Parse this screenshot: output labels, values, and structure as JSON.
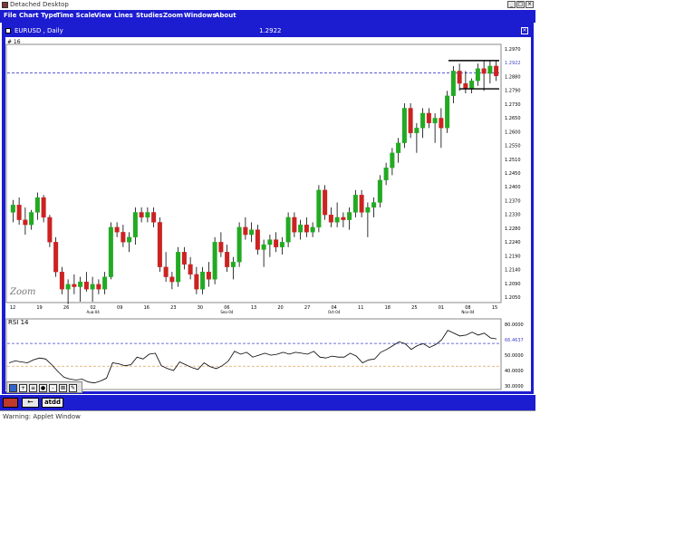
{
  "window": {
    "title": "Detached Desktop",
    "btn_min": "_",
    "btn_max": "□",
    "btn_close": "×"
  },
  "menu": [
    "File",
    "Chart Type",
    "Time Scale",
    "View",
    "Lines",
    "Studies",
    "Zoom",
    "Windows",
    "About"
  ],
  "symbol_bar": {
    "label": "EURUSD , Daily",
    "last_price": "1.2922",
    "close": "×"
  },
  "chart_panel_label": "# 16",
  "zoom_label": "Zoom",
  "chart_data": {
    "type": "candlestick",
    "title": "EURUSD , Daily",
    "last_price_line": 1.2922,
    "ylim": [
      1.2,
      1.303
    ],
    "y_ticks": [
      "1.2970",
      "1.2922",
      "1.2880",
      "1.2790",
      "1.2730",
      "1.2650",
      "1.2600",
      "1.2550",
      "1.2510",
      "1.2450",
      "1.2400",
      "1.2370",
      "1.2330",
      "1.2280",
      "1.2240",
      "1.2190",
      "1.2140",
      "1.2090",
      "1.2050"
    ],
    "x_ticks": [
      "12",
      "19",
      "26",
      "02",
      "09",
      "16",
      "23",
      "30",
      "06",
      "13",
      "20",
      "27",
      "04",
      "11",
      "18",
      "25",
      "01",
      "08",
      "15"
    ],
    "x_tick_sub": [
      {
        "after_index": 3,
        "label": "Aug-04"
      },
      {
        "after_index": 8,
        "label": "Sep-04"
      },
      {
        "after_index": 12,
        "label": "Oct-04"
      },
      {
        "after_index": 17,
        "label": "Nov-04"
      }
    ],
    "candles": [
      [
        1.236,
        1.241,
        1.232,
        1.239
      ],
      [
        1.239,
        1.242,
        1.231,
        1.233
      ],
      [
        1.233,
        1.238,
        1.227,
        1.231
      ],
      [
        1.231,
        1.237,
        1.229,
        1.236
      ],
      [
        1.236,
        1.244,
        1.233,
        1.242
      ],
      [
        1.242,
        1.243,
        1.232,
        1.234
      ],
      [
        1.234,
        1.235,
        1.222,
        1.224
      ],
      [
        1.224,
        1.226,
        1.21,
        1.212
      ],
      [
        1.212,
        1.214,
        1.203,
        1.205
      ],
      [
        1.205,
        1.209,
        1.199,
        1.207
      ],
      [
        1.207,
        1.211,
        1.203,
        1.206
      ],
      [
        1.206,
        1.21,
        1.2,
        1.208
      ],
      [
        1.208,
        1.212,
        1.204,
        1.205
      ],
      [
        1.205,
        1.21,
        1.2,
        1.207
      ],
      [
        1.207,
        1.209,
        1.203,
        1.205
      ],
      [
        1.205,
        1.212,
        1.203,
        1.21
      ],
      [
        1.21,
        1.232,
        1.209,
        1.23
      ],
      [
        1.23,
        1.232,
        1.226,
        1.228
      ],
      [
        1.228,
        1.231,
        1.222,
        1.224
      ],
      [
        1.224,
        1.228,
        1.22,
        1.226
      ],
      [
        1.226,
        1.238,
        1.223,
        1.236
      ],
      [
        1.236,
        1.238,
        1.232,
        1.234
      ],
      [
        1.234,
        1.238,
        1.232,
        1.236
      ],
      [
        1.236,
        1.238,
        1.23,
        1.232
      ],
      [
        1.232,
        1.234,
        1.212,
        1.214
      ],
      [
        1.214,
        1.22,
        1.208,
        1.21
      ],
      [
        1.21,
        1.212,
        1.205,
        1.208
      ],
      [
        1.208,
        1.222,
        1.206,
        1.22
      ],
      [
        1.22,
        1.222,
        1.213,
        1.215
      ],
      [
        1.215,
        1.218,
        1.209,
        1.211
      ],
      [
        1.211,
        1.214,
        1.203,
        1.205
      ],
      [
        1.205,
        1.214,
        1.203,
        1.212
      ],
      [
        1.212,
        1.216,
        1.206,
        1.209
      ],
      [
        1.209,
        1.226,
        1.207,
        1.224
      ],
      [
        1.224,
        1.228,
        1.218,
        1.22
      ],
      [
        1.22,
        1.223,
        1.212,
        1.214
      ],
      [
        1.214,
        1.218,
        1.209,
        1.216
      ],
      [
        1.216,
        1.232,
        1.214,
        1.23
      ],
      [
        1.23,
        1.234,
        1.225,
        1.227
      ],
      [
        1.227,
        1.232,
        1.224,
        1.229
      ],
      [
        1.229,
        1.231,
        1.219,
        1.221
      ],
      [
        1.221,
        1.225,
        1.214,
        1.223
      ],
      [
        1.223,
        1.227,
        1.218,
        1.225
      ],
      [
        1.225,
        1.228,
        1.22,
        1.222
      ],
      [
        1.222,
        1.226,
        1.219,
        1.224
      ],
      [
        1.224,
        1.236,
        1.222,
        1.234
      ],
      [
        1.234,
        1.236,
        1.226,
        1.228
      ],
      [
        1.228,
        1.233,
        1.225,
        1.231
      ],
      [
        1.231,
        1.234,
        1.226,
        1.228
      ],
      [
        1.228,
        1.232,
        1.226,
        1.23
      ],
      [
        1.23,
        1.247,
        1.228,
        1.245
      ],
      [
        1.245,
        1.247,
        1.233,
        1.235
      ],
      [
        1.235,
        1.238,
        1.23,
        1.232
      ],
      [
        1.232,
        1.24,
        1.23,
        1.234
      ],
      [
        1.234,
        1.236,
        1.23,
        1.233
      ],
      [
        1.233,
        1.238,
        1.229,
        1.236
      ],
      [
        1.236,
        1.245,
        1.234,
        1.243
      ],
      [
        1.243,
        1.245,
        1.234,
        1.236
      ],
      [
        1.236,
        1.24,
        1.226,
        1.238
      ],
      [
        1.238,
        1.242,
        1.234,
        1.24
      ],
      [
        1.24,
        1.251,
        1.238,
        1.249
      ],
      [
        1.249,
        1.256,
        1.247,
        1.254
      ],
      [
        1.254,
        1.262,
        1.251,
        1.26
      ],
      [
        1.26,
        1.266,
        1.256,
        1.264
      ],
      [
        1.264,
        1.28,
        1.262,
        1.278
      ],
      [
        1.278,
        1.28,
        1.266,
        1.268
      ],
      [
        1.268,
        1.272,
        1.26,
        1.27
      ],
      [
        1.27,
        1.278,
        1.266,
        1.276
      ],
      [
        1.276,
        1.278,
        1.27,
        1.272
      ],
      [
        1.272,
        1.276,
        1.264,
        1.274
      ],
      [
        1.274,
        1.278,
        1.262,
        1.27
      ],
      [
        1.27,
        1.285,
        1.268,
        1.283
      ],
      [
        1.283,
        1.295,
        1.28,
        1.293
      ],
      [
        1.293,
        1.296,
        1.285,
        1.288
      ],
      [
        1.288,
        1.293,
        1.284,
        1.286
      ],
      [
        1.286,
        1.29,
        1.284,
        1.289
      ],
      [
        1.289,
        1.296,
        1.287,
        1.294
      ],
      [
        1.294,
        1.297,
        1.285,
        1.292
      ],
      [
        1.292,
        1.297,
        1.288,
        1.295
      ],
      [
        1.295,
        1.297,
        1.289,
        1.291
      ]
    ],
    "annotations": {
      "resistance": 1.2972,
      "support": 1.2858,
      "start_index": 72
    }
  },
  "rsi": {
    "label": "RSI 14",
    "ylim": [
      20,
      90
    ],
    "y_ticks": [
      "80.0000",
      "66.4637",
      "50.0000",
      "40.0000",
      "30.0000"
    ],
    "ref_upper": 70,
    "ref_lower": 30,
    "values": [
      46,
      48,
      47,
      46,
      49,
      51,
      50,
      44,
      37,
      31,
      29,
      28,
      29,
      26,
      25,
      27,
      30,
      46,
      45,
      43,
      44,
      52,
      50,
      55,
      56,
      43,
      40,
      38,
      47,
      44,
      41,
      39,
      46,
      42,
      40,
      43,
      48,
      58,
      55,
      57,
      52,
      54,
      56,
      54,
      55,
      57,
      55,
      57,
      56,
      55,
      58,
      52,
      51,
      53,
      52,
      52,
      56,
      53,
      46,
      49,
      50,
      57,
      60,
      64,
      68,
      66,
      60,
      64,
      66,
      62,
      65,
      70,
      80,
      77,
      74,
      75,
      78,
      75,
      77,
      72,
      71
    ]
  },
  "toolbar_icons": [
    "chart-icon",
    "crosshair-icon",
    "list-icon",
    "dot-icon",
    "line-icon",
    "zoom-icon",
    "pencil-icon"
  ],
  "taskbar": {
    "back": "←",
    "tab": "atdd"
  },
  "status": {
    "text": "Warning: Applet Window"
  },
  "colors": {
    "accent": "#1c1cd0",
    "up_candle": "#22aa22",
    "down_candle": "#cc2222",
    "dashed_line": "#4444cc"
  }
}
